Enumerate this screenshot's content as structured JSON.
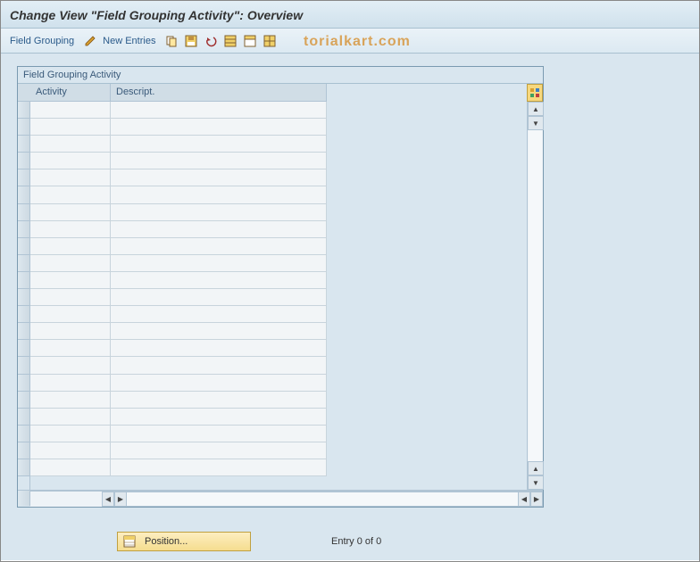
{
  "header": {
    "title": "Change View \"Field Grouping Activity\": Overview"
  },
  "toolbar": {
    "field_grouping_label": "Field Grouping",
    "new_entries_label": "New Entries"
  },
  "watermark": "torialkart.com",
  "panel": {
    "title": "Field Grouping Activity",
    "columns": {
      "activity": "Activity",
      "descript": "Descript."
    }
  },
  "footer": {
    "position_label": "Position...",
    "entry_text": "Entry 0 of 0"
  }
}
